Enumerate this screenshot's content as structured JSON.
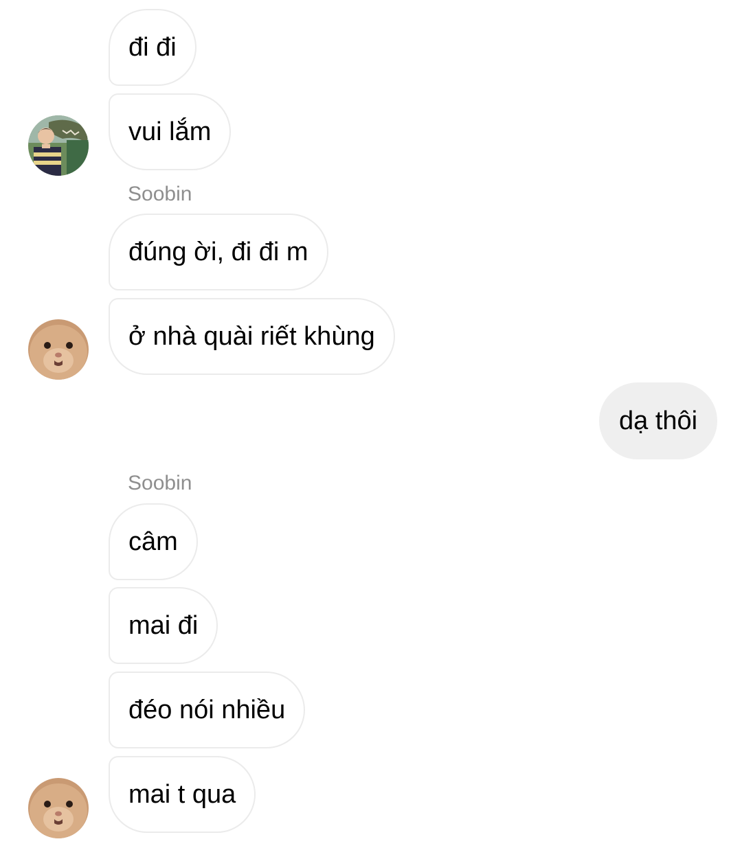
{
  "thread": {
    "messages": [
      {
        "text": "đi đi"
      },
      {
        "text": "vui lắm"
      },
      {
        "text": "đúng ời, đi đi m"
      },
      {
        "text": "ở nhà quài riết khùng"
      },
      {
        "text": "dạ thôi"
      },
      {
        "text": "câm"
      },
      {
        "text": "mai đi"
      },
      {
        "text": "đéo nói nhiều"
      },
      {
        "text": "mai t qua"
      }
    ],
    "sender_labels": [
      "Soobin",
      "Soobin"
    ]
  },
  "avatars": [
    {
      "icon": "boy-with-dinosaur-avatar"
    },
    {
      "icon": "hamster-avatar"
    },
    {
      "icon": "hamster-avatar"
    }
  ],
  "colors": {
    "incoming_bubble_border": "#ebebeb",
    "outgoing_bubble_bg": "#efefef",
    "sender_label": "#8e8e8e",
    "text": "#000000"
  }
}
